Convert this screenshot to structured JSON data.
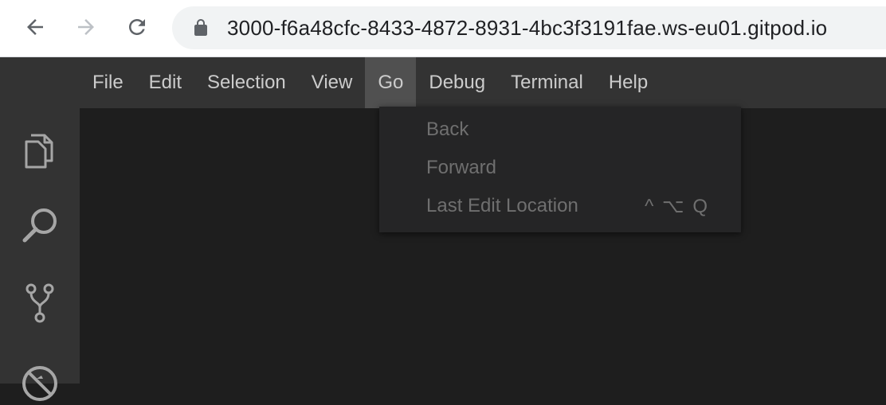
{
  "browser": {
    "url": "3000-f6a48cfc-8433-4872-8931-4bc3f3191fae.ws-eu01.gitpod.io",
    "icons": [
      "back-arrow-icon",
      "forward-arrow-icon",
      "reload-icon",
      "lock-icon"
    ],
    "colors": {
      "chrome_bg": "#ffffff",
      "omnibox_bg": "#f1f3f4",
      "text": "#202124",
      "icon": "#5f6368",
      "icon_disabled": "#bdc1c6"
    }
  },
  "menubar": {
    "items": [
      {
        "label": "File"
      },
      {
        "label": "Edit"
      },
      {
        "label": "Selection"
      },
      {
        "label": "View"
      },
      {
        "label": "Go",
        "active": true
      },
      {
        "label": "Debug"
      },
      {
        "label": "Terminal"
      },
      {
        "label": "Help"
      }
    ]
  },
  "go_menu": {
    "items": [
      {
        "label": "Back",
        "shortcut": "",
        "disabled": true
      },
      {
        "label": "Forward",
        "shortcut": "",
        "disabled": true
      },
      {
        "label": "Last Edit Location",
        "shortcut": "^ ⌥ Q",
        "disabled": true
      }
    ]
  },
  "activity_bar": {
    "icons": [
      "explorer-icon",
      "search-icon",
      "source-control-icon",
      "debug-icon"
    ]
  },
  "theme": {
    "menubar_bg": "#333333",
    "menu_active_bg": "#505050",
    "menu_text": "#cccccc",
    "dropdown_bg": "#252526",
    "dropdown_text_disabled": "#6f6f6f",
    "editor_bg": "#1e1e1e",
    "activity_icon": "#a6a6a6"
  }
}
